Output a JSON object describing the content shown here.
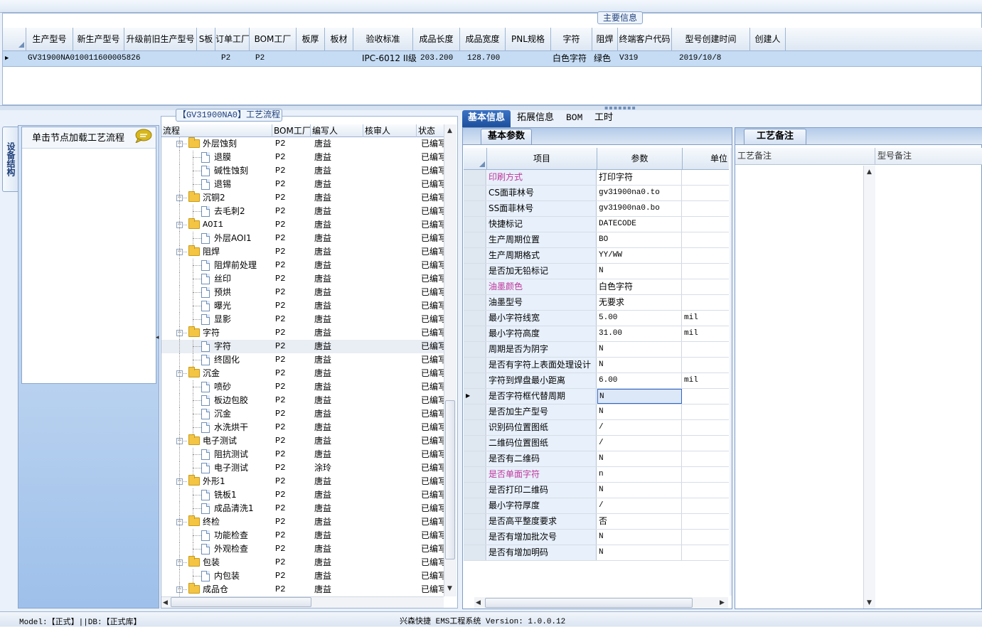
{
  "main_info": {
    "title": "主要信息",
    "columns": [
      "生产型号",
      "新生产型号",
      "升级前旧生产型号",
      "S板",
      "订单工厂",
      "BOM工厂",
      "板厚",
      "板材",
      "验收标准",
      "成品长度",
      "成品宽度",
      "PNL规格",
      "字符",
      "阻焊",
      "终端客户代码",
      "型号创建时间",
      "创建人"
    ],
    "row": {
      "生产型号": "GV31900NA0",
      "新生产型号": "10011600005826",
      "订单工厂": "P2",
      "BOM工厂": "P2",
      "验收标准": "IPC-6012 II级",
      "成品长度": "203.200",
      "成品宽度": "128.700",
      "字符": "白色字符",
      "阻焊": "绿色",
      "终端客户代码": "V319",
      "型号创建时间": "2019/10/8"
    }
  },
  "side": {
    "tab_label": "设备结构",
    "hint": "单击节点加载工艺流程",
    "hint_icon": "speech-bubble-icon"
  },
  "flow": {
    "title": "【GV31900NA0】工艺流程",
    "columns": [
      "流程",
      "BOM工厂",
      "编写人",
      "核审人",
      "状态"
    ],
    "rows": [
      {
        "level": 1,
        "name": "外层蚀刻",
        "factory": "P2",
        "writer": "唐益",
        "status": "已编写"
      },
      {
        "level": 2,
        "name": "退膜",
        "factory": "P2",
        "writer": "唐益",
        "status": "已编写"
      },
      {
        "level": 2,
        "name": "碱性蚀刻",
        "factory": "P2",
        "writer": "唐益",
        "status": "已编写"
      },
      {
        "level": 2,
        "name": "退锡",
        "factory": "P2",
        "writer": "唐益",
        "status": "已编写"
      },
      {
        "level": 1,
        "name": "沉铜2",
        "factory": "P2",
        "writer": "唐益",
        "status": "已编写"
      },
      {
        "level": 2,
        "name": "去毛刺2",
        "factory": "P2",
        "writer": "唐益",
        "status": "已编写"
      },
      {
        "level": 1,
        "name": "AOI1",
        "factory": "P2",
        "writer": "唐益",
        "status": "已编写"
      },
      {
        "level": 2,
        "name": "外层AOI1",
        "factory": "P2",
        "writer": "唐益",
        "status": "已编写"
      },
      {
        "level": 1,
        "name": "阻焊",
        "factory": "P2",
        "writer": "唐益",
        "status": "已编写"
      },
      {
        "level": 2,
        "name": "阻焊前处理",
        "factory": "P2",
        "writer": "唐益",
        "status": "已编写"
      },
      {
        "level": 2,
        "name": "丝印",
        "factory": "P2",
        "writer": "唐益",
        "status": "已编写"
      },
      {
        "level": 2,
        "name": "预烘",
        "factory": "P2",
        "writer": "唐益",
        "status": "已编写"
      },
      {
        "level": 2,
        "name": "曝光",
        "factory": "P2",
        "writer": "唐益",
        "status": "已编写"
      },
      {
        "level": 2,
        "name": "显影",
        "factory": "P2",
        "writer": "唐益",
        "status": "已编写"
      },
      {
        "level": 1,
        "name": "字符",
        "factory": "P2",
        "writer": "唐益",
        "status": "已编写"
      },
      {
        "level": 2,
        "name": "字符",
        "factory": "P2",
        "writer": "唐益",
        "status": "已编写",
        "selected": true
      },
      {
        "level": 2,
        "name": "终固化",
        "factory": "P2",
        "writer": "唐益",
        "status": "已编写"
      },
      {
        "level": 1,
        "name": "沉金",
        "factory": "P2",
        "writer": "唐益",
        "status": "已编写"
      },
      {
        "level": 2,
        "name": "喷砂",
        "factory": "P2",
        "writer": "唐益",
        "status": "已编写"
      },
      {
        "level": 2,
        "name": "板边包胶",
        "factory": "P2",
        "writer": "唐益",
        "status": "已编写"
      },
      {
        "level": 2,
        "name": "沉金",
        "factory": "P2",
        "writer": "唐益",
        "status": "已编写"
      },
      {
        "level": 2,
        "name": "水洗烘干",
        "factory": "P2",
        "writer": "唐益",
        "status": "已编写"
      },
      {
        "level": 1,
        "name": "电子测试",
        "factory": "P2",
        "writer": "唐益",
        "status": "已编写"
      },
      {
        "level": 2,
        "name": "阻抗测试",
        "factory": "P2",
        "writer": "唐益",
        "status": "已编写"
      },
      {
        "level": 2,
        "name": "电子测试",
        "factory": "P2",
        "writer": "涂玲",
        "status": "已编写"
      },
      {
        "level": 1,
        "name": "外形1",
        "factory": "P2",
        "writer": "唐益",
        "status": "已编写"
      },
      {
        "level": 2,
        "name": "铣板1",
        "factory": "P2",
        "writer": "唐益",
        "status": "已编写"
      },
      {
        "level": 2,
        "name": "成品清洗1",
        "factory": "P2",
        "writer": "唐益",
        "status": "已编写"
      },
      {
        "level": 1,
        "name": "终检",
        "factory": "P2",
        "writer": "唐益",
        "status": "已编写"
      },
      {
        "level": 2,
        "name": "功能检查",
        "factory": "P2",
        "writer": "唐益",
        "status": "已编写"
      },
      {
        "level": 2,
        "name": "外观检查",
        "factory": "P2",
        "writer": "唐益",
        "status": "已编写"
      },
      {
        "level": 1,
        "name": "包装",
        "factory": "P2",
        "writer": "唐益",
        "status": "已编写"
      },
      {
        "level": 2,
        "name": "内包装",
        "factory": "P2",
        "writer": "唐益",
        "status": "已编写"
      },
      {
        "level": 1,
        "name": "成品仓",
        "factory": "P2",
        "writer": "唐益",
        "status": "已编写"
      }
    ]
  },
  "tabs": [
    "基本信息",
    "拓展信息",
    "BOM",
    "工时"
  ],
  "params": {
    "tab": "基本参数",
    "columns": [
      "项目",
      "参数",
      "单位"
    ],
    "rows": [
      {
        "key": "印刷方式",
        "value": "打印字符",
        "unit": "",
        "pink": true
      },
      {
        "key": "CS面菲林号",
        "value": "gv31900na0.to",
        "unit": ""
      },
      {
        "key": "SS面菲林号",
        "value": "gv31900na0.bo",
        "unit": ""
      },
      {
        "key": "快捷标记",
        "value": "DATECODE",
        "unit": ""
      },
      {
        "key": "生产周期位置",
        "value": "BO",
        "unit": ""
      },
      {
        "key": "生产周期格式",
        "value": "YY/WW",
        "unit": ""
      },
      {
        "key": "是否加无铅标记",
        "value": "N",
        "unit": ""
      },
      {
        "key": "油墨颜色",
        "value": "白色字符",
        "unit": "",
        "pink": true
      },
      {
        "key": "油墨型号",
        "value": "无要求",
        "unit": ""
      },
      {
        "key": "最小字符线宽",
        "value": "5.00",
        "unit": "mil"
      },
      {
        "key": "最小字符高度",
        "value": "31.00",
        "unit": "mil"
      },
      {
        "key": "周期是否为阴字",
        "value": "N",
        "unit": ""
      },
      {
        "key": "是否有字符上表面处理设计",
        "value": "N",
        "unit": ""
      },
      {
        "key": "字符到焊盘最小距离",
        "value": "6.00",
        "unit": "mil"
      },
      {
        "key": "是否字符框代替周期",
        "value": "N",
        "unit": "",
        "current": true
      },
      {
        "key": "是否加生产型号",
        "value": "N",
        "unit": ""
      },
      {
        "key": "识别码位置图纸",
        "value": "/",
        "unit": ""
      },
      {
        "key": "二维码位置图纸",
        "value": "/",
        "unit": ""
      },
      {
        "key": "是否有二维码",
        "value": "N",
        "unit": ""
      },
      {
        "key": "是否单面字符",
        "value": "n",
        "unit": "",
        "pink": true
      },
      {
        "key": "是否打印二维码",
        "value": "N",
        "unit": ""
      },
      {
        "key": "最小字符厚度",
        "value": "/",
        "unit": ""
      },
      {
        "key": "是否高平整度要求",
        "value": "否",
        "unit": ""
      },
      {
        "key": "是否有增加批次号",
        "value": "N",
        "unit": ""
      },
      {
        "key": "是否有增加明码",
        "value": "N",
        "unit": ""
      }
    ]
  },
  "remarks": {
    "tab": "工艺备注",
    "columns": [
      "工艺备注",
      "型号备注"
    ]
  },
  "status": {
    "left": "Model:【正式】||DB:【正式库】",
    "center": "兴森快捷 EMS工程系统 Version: 1.0.0.12"
  },
  "colors": {
    "accent": "#1d4f9c",
    "selected_row": "#c5dcf4",
    "pink": "#c0369a"
  }
}
